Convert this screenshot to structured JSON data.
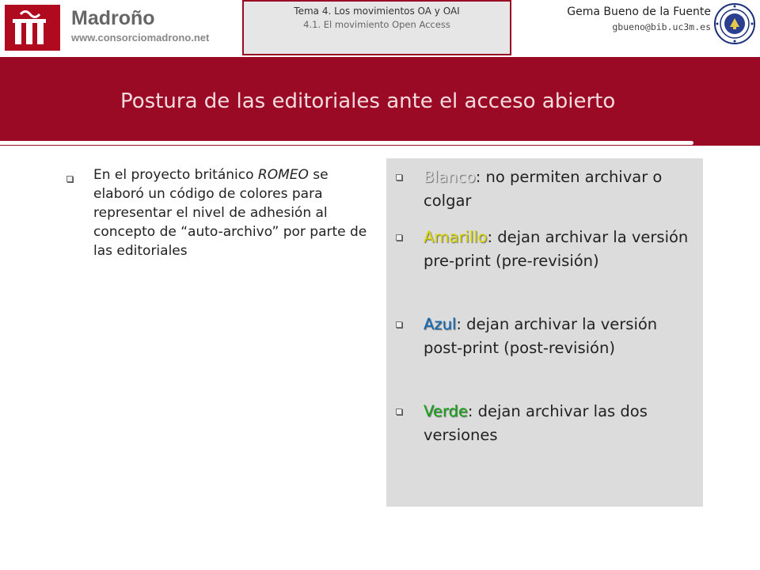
{
  "header": {
    "logo_name": "Madroño",
    "logo_url": "www.consorciomadrono.net",
    "tema_line1": "Tema 4. Los movimientos OA y OAI",
    "tema_line2": "4.1. El movimiento Open Access",
    "author_name": "Gema Bueno de la Fuente",
    "author_email": "gbueno@bib.uc3m.es",
    "seal_icon": "university-seal-icon"
  },
  "slide": {
    "title": "Postura de las editoriales ante el acceso abierto"
  },
  "left_bullet": {
    "text_before": "En el proyecto británico",
    "italic_word": "ROMEO",
    "text_after": "se elaboró un código de colores para representar el nivel de adhesión al concepto de “auto-archivo” por parte de las editoriales"
  },
  "colors": {
    "title_band": "#9b0a24",
    "title_text": "#f4dbe0",
    "panel": "#dcdcdc",
    "blanco": "#dcdcdc",
    "amarillo": "#d8d800",
    "azul": "#0a6ab8",
    "verde": "#12a412"
  },
  "right_items": [
    {
      "keyword": "Blanco",
      "text": ": no permiten archivar o colgar"
    },
    {
      "keyword": "Amarillo",
      "text": ": dejan archivar la versión pre-print (pre-revisión)"
    },
    {
      "keyword": "Azul",
      "text": ": dejan archivar la versión post-print (post-revisión)"
    },
    {
      "keyword": "Verde",
      "text": ": dejan archivar las dos versiones"
    }
  ]
}
